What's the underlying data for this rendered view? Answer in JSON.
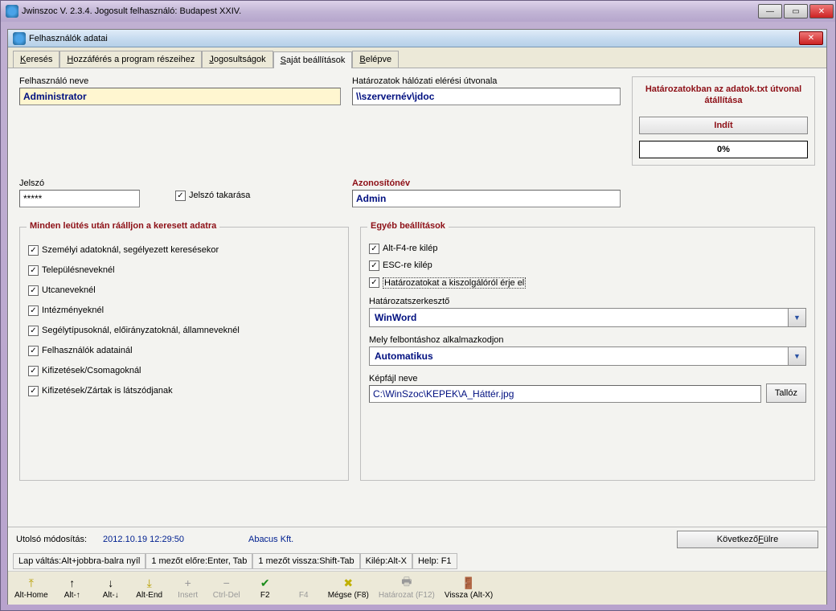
{
  "outer": {
    "title": "Jwinszoc V. 2.3.4.  Jogosult felhasználó: Budapest XXIV."
  },
  "inner": {
    "title": "Felhasználók adatai"
  },
  "tabs": [
    {
      "label": "Keresés",
      "u": "K",
      "rest": "eresés"
    },
    {
      "label": "Hozzáférés a program részeihez",
      "u": "H",
      "rest": "ozzáférés a program részeihez"
    },
    {
      "label": "Jogosultságok",
      "u": "J",
      "rest": "ogosultságok"
    },
    {
      "label": "Saját beállítások",
      "u": "S",
      "rest": "aját beállítások"
    },
    {
      "label": "Belépve",
      "u": "B",
      "rest": "elépve"
    }
  ],
  "fields": {
    "username_label": "Felhasználó neve",
    "username": "Administrator",
    "netpath_label": "Határozatok hálózati elérési útvonala",
    "netpath": "\\\\szervernév\\jdoc",
    "password_label": "Jelszó",
    "password": "*****",
    "hidepw_label": "Jelszó takarása",
    "idname_label": "Azonosítónév",
    "idname": "Admin"
  },
  "sidepanel": {
    "title": "Határozatokban az adatok.txt útvonal átállítása",
    "button": "Indít",
    "progress": "0%"
  },
  "group1": {
    "title": "Minden leütés után ráálljon a keresett adatra",
    "items": [
      "Személyi adatoknál, segélyezett keresésekor",
      "Településneveknél",
      "Utcaneveknél",
      "Intézményeknél",
      "Segélytípusoknál, előirányzatoknál, államneveknél",
      "Felhasználók adatainál",
      "Kifizetések/Csomagoknál",
      "Kifizetések/Zártak is látszódjanak"
    ]
  },
  "group2": {
    "title": "Egyéb beállítások",
    "altf4": "Alt-F4-re kilép",
    "esc": "ESC-re kilép",
    "server": "Határozatokat a kiszolgálóról érje el",
    "editor_label": "Határozatszerkesztő",
    "editor_value": "WinWord",
    "reso_label": "Mely felbontáshoz alkalmazkodjon",
    "reso_value": "Automatikus",
    "img_label": "Képfájl neve",
    "img_value": "C:\\WinSzoc\\KEPEK\\A_Háttér.jpg",
    "browse": "Tallóz"
  },
  "status": {
    "lastmod_label": "Utolsó módosítás:",
    "lastmod_value": "2012.10.19 12:29:50",
    "company": "Abacus Kft.",
    "next_tab_pre": "Következő ",
    "next_tab_u": "F",
    "next_tab_post": "ülre"
  },
  "hints": [
    "Lap váltás:Alt+jobbra-balra nyíl",
    "1 mezőt előre:Enter, Tab",
    "1 mezőt vissza:Shift-Tab",
    "Kilép:Alt-X",
    "Help: F1"
  ],
  "toolbar": [
    {
      "icon": "⤒",
      "label": "Alt-Home",
      "color": "#b8a000"
    },
    {
      "icon": "↑",
      "label": "Alt-↑",
      "color": "#000"
    },
    {
      "icon": "↓",
      "label": "Alt-↓",
      "color": "#000"
    },
    {
      "icon": "⤓",
      "label": "Alt-End",
      "color": "#b8a000"
    },
    {
      "icon": "+",
      "label": "Insert",
      "disabled": true
    },
    {
      "icon": "−",
      "label": "Ctrl-Del",
      "disabled": true
    },
    {
      "icon": "✔",
      "label": "F2",
      "color": "#1a8c1a"
    },
    {
      "icon": " ",
      "label": "F4",
      "disabled": true
    },
    {
      "icon": "✖",
      "label": "Mégse (F8)",
      "color": "#c0b000"
    },
    {
      "icon": "🖶",
      "label": "Határozat (F12)",
      "disabled": true
    },
    {
      "icon": "🚪",
      "label": "Vissza (Alt-X)",
      "color": "#3a5cc0"
    }
  ]
}
